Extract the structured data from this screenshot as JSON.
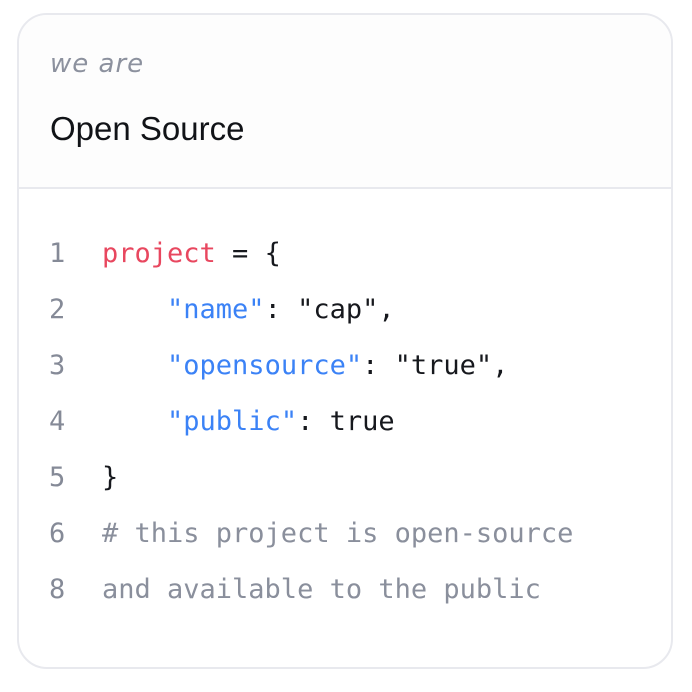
{
  "card": {
    "eyebrow": "we are",
    "title": "Open Source"
  },
  "code": {
    "lines": [
      {
        "number": "1",
        "segments": [
          "project",
          " = {"
        ]
      },
      {
        "number": "2",
        "segments": [
          "    ",
          "\"name\"",
          ": \"cap\","
        ]
      },
      {
        "number": "3",
        "segments": [
          "    ",
          "\"opensource\"",
          ": \"true\","
        ]
      },
      {
        "number": "4",
        "segments": [
          "    ",
          "\"public\"",
          ": true"
        ]
      },
      {
        "number": "5",
        "segments": [
          "}"
        ]
      },
      {
        "number": "6",
        "segments": [
          "# this project is open-source"
        ]
      },
      {
        "number": "8",
        "segments": [
          "and available to the public"
        ]
      }
    ]
  },
  "colors": {
    "keyword": "#e8475f",
    "key": "#3b82f6",
    "text": "#16181d",
    "comment": "#8a8f9c",
    "line_number": "#858a97",
    "border": "#e8e9ee"
  }
}
